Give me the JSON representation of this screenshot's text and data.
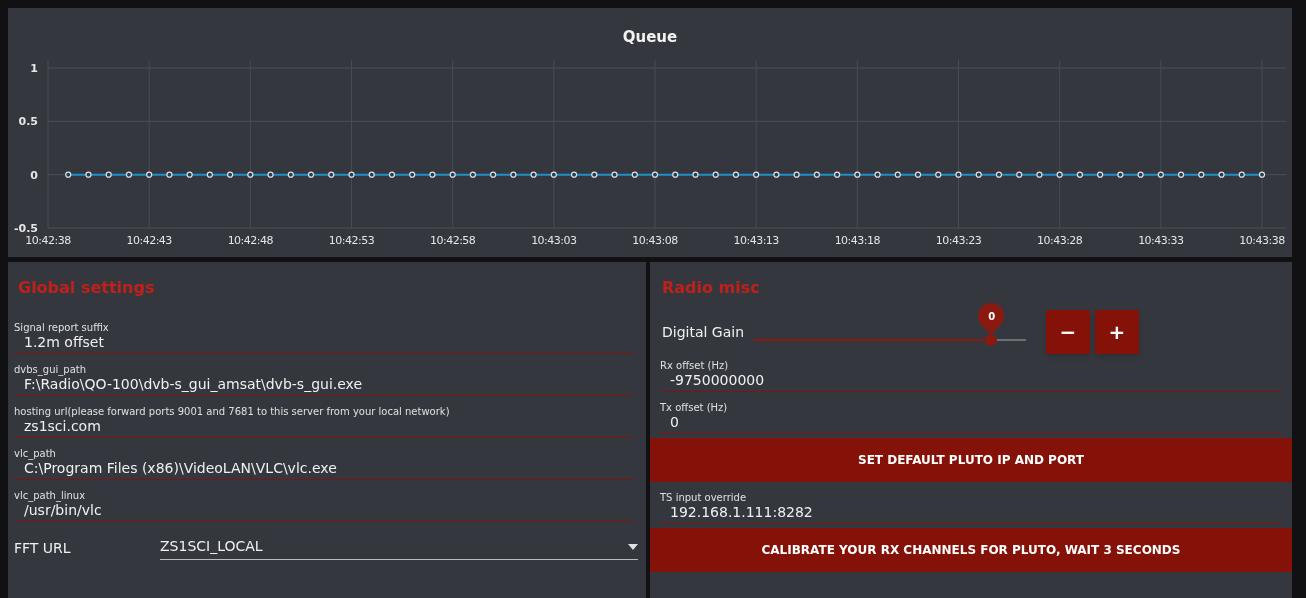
{
  "queue_chart": {
    "chart_data": {
      "type": "line",
      "title": "Queue",
      "categories": [
        "10:42:38",
        null,
        null,
        null,
        null,
        "10:42:43",
        null,
        null,
        null,
        null,
        "10:42:48",
        null,
        null,
        null,
        null,
        "10:42:53",
        null,
        null,
        null,
        null,
        "10:42:58",
        null,
        null,
        null,
        null,
        "10:43:03",
        null,
        null,
        null,
        null,
        "10:43:08",
        null,
        null,
        null,
        null,
        "10:43:13",
        null,
        null,
        null,
        null,
        "10:43:18",
        null,
        null,
        null,
        null,
        "10:43:23",
        null,
        null,
        null,
        null,
        "10:43:28",
        null,
        null,
        null,
        null,
        "10:43:33",
        null,
        null,
        null,
        null,
        "10:43:38"
      ],
      "series": [
        {
          "color": "#1f8fc8",
          "marker": "circle",
          "values": [
            null,
            0,
            0,
            0,
            0,
            0,
            0,
            0,
            0,
            0,
            0,
            0,
            0,
            0,
            0,
            0,
            0,
            0,
            0,
            0,
            0,
            0,
            0,
            0,
            0,
            0,
            0,
            0,
            0,
            0,
            0,
            0,
            0,
            0,
            0,
            0,
            0,
            0,
            0,
            0,
            0,
            0,
            0,
            0,
            0,
            0,
            0,
            0,
            0,
            0,
            0,
            0,
            0,
            0,
            0,
            0,
            0,
            0,
            0,
            0,
            0
          ]
        }
      ],
      "grid": true,
      "ylim": [
        -0.5,
        1
      ],
      "yticks": [
        -0.5,
        0,
        0.5,
        1
      ]
    }
  },
  "global_settings": {
    "title": "Global settings",
    "fields": [
      {
        "label": "Signal report suffix",
        "value": "1.2m offset"
      },
      {
        "label": "dvbs_gui_path",
        "value": "F:\\Radio\\QO-100\\dvb-s_gui_amsat\\dvb-s_gui.exe"
      },
      {
        "label": "hosting url(please forward ports 9001 and 7681 to this server from your local network)",
        "value": "zs1sci.com"
      },
      {
        "label": "vlc_path",
        "value": "C:\\Program Files (x86)\\VideoLAN\\VLC\\vlc.exe"
      },
      {
        "label": "vlc_path_linux",
        "value": "/usr/bin/vlc"
      }
    ],
    "fft_url": {
      "label": "FFT URL",
      "value": "ZS1SCI_LOCAL"
    }
  },
  "radio_misc": {
    "title": "Radio misc",
    "digital_gain": {
      "label": "Digital Gain",
      "reading": "0",
      "level": 0.87,
      "minus": "−",
      "plus": "+"
    },
    "items": [
      {
        "kind": "field",
        "label": "Rx offset (Hz)",
        "value": "-9750000000"
      },
      {
        "kind": "field",
        "label": "Tx offset (Hz)",
        "value": "0"
      },
      {
        "kind": "button",
        "label": "SET DEFAULT PLUTO IP AND PORT"
      },
      {
        "kind": "field",
        "label": "TS input override",
        "value": "192.168.1.111:8282"
      },
      {
        "kind": "button",
        "label": "CALIBRATE YOUR RX CHANNELS FOR PLUTO, WAIT 3 SECONDS"
      }
    ]
  }
}
